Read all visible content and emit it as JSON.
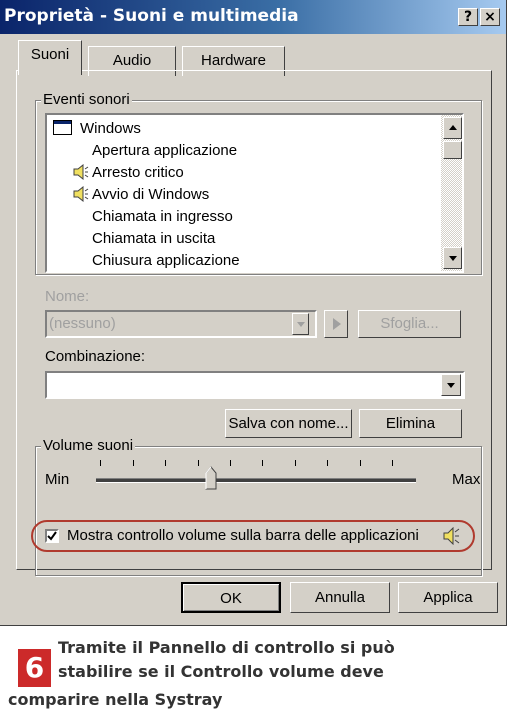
{
  "window": {
    "title": "Proprietà - Suoni e multimedia",
    "help_button": "?",
    "close_button": "×"
  },
  "tabs": [
    {
      "label": "Suoni",
      "active": true
    },
    {
      "label": "Audio",
      "active": false
    },
    {
      "label": "Hardware",
      "active": false
    }
  ],
  "events_group": {
    "label": "Eventi sonori",
    "items": [
      {
        "label": "Windows",
        "icon": "window-icon"
      },
      {
        "label": "Apertura applicazione",
        "icon": null
      },
      {
        "label": "Arresto critico",
        "icon": "speaker-icon"
      },
      {
        "label": "Avvio di Windows",
        "icon": "speaker-icon"
      },
      {
        "label": "Chiamata in ingresso",
        "icon": null
      },
      {
        "label": "Chiamata in uscita",
        "icon": null
      },
      {
        "label": "Chiusura applicazione",
        "icon": null
      }
    ]
  },
  "name_field": {
    "label": "Nome:",
    "value": "(nessuno)",
    "browse_label": "Sfoglia..."
  },
  "scheme_field": {
    "label": "Combinazione:",
    "value": "",
    "save_as_label": "Salva con nome...",
    "delete_label": "Elimina"
  },
  "volume_group": {
    "label": "Volume suoni",
    "min_label": "Min",
    "max_label": "Max",
    "level_fraction": 0.38,
    "checkbox_label": "Mostra controllo volume sulla barra delle applicazioni",
    "checkbox_checked": true
  },
  "footer": {
    "ok_label": "OK",
    "cancel_label": "Annulla",
    "apply_label": "Applica"
  },
  "caption": {
    "number": "6",
    "line1": "Tramite il Pannello di controllo si può",
    "line2": "stabilire se il Controllo volume deve",
    "line3": "comparire nella Systray"
  },
  "colors": {
    "titlebar": "#0a246a",
    "highlight_outline": "#b03a2e",
    "caption_badge": "#cc2a2a"
  }
}
